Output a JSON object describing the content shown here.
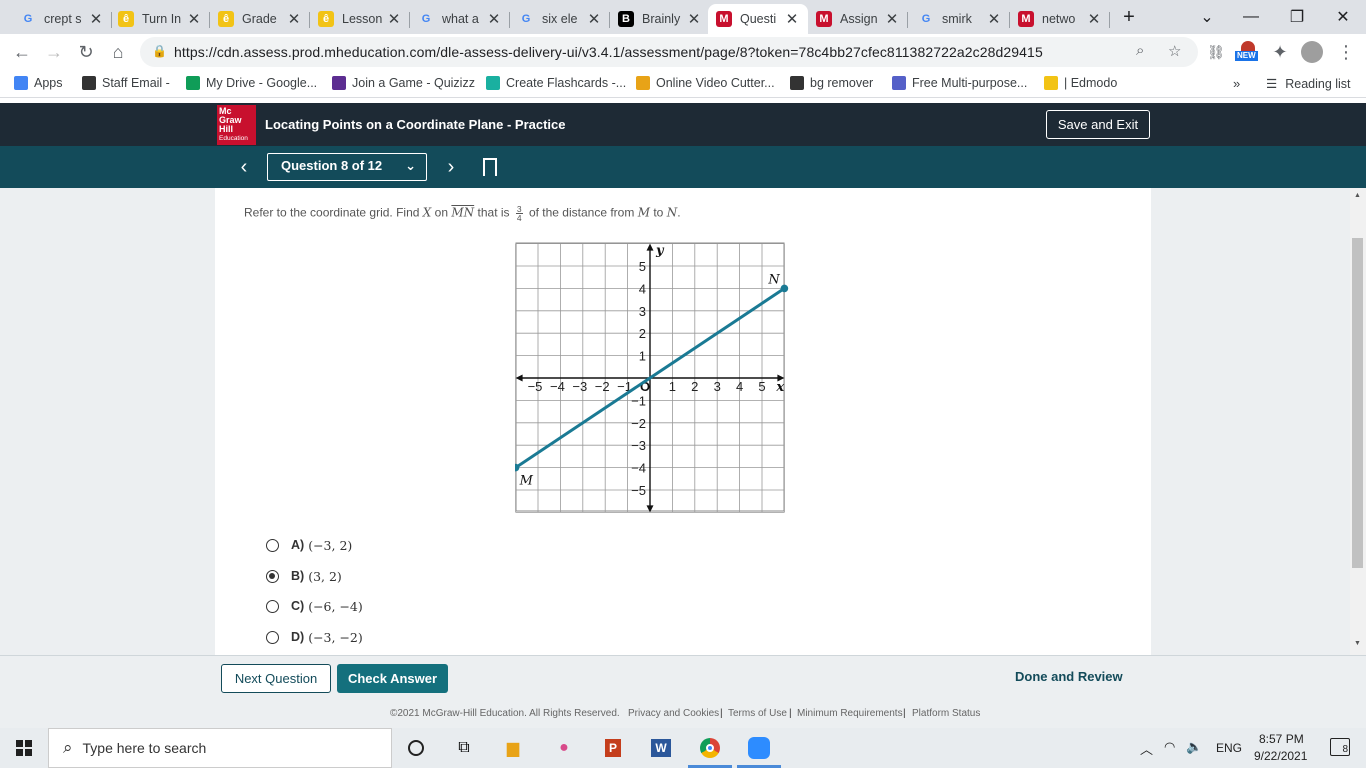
{
  "browser": {
    "tabs": [
      {
        "title": "crept s",
        "favicon": "google-icon",
        "color": "#4285f4",
        "glyph": "G"
      },
      {
        "title": "Turn In",
        "favicon": "edmodo-icon",
        "color": "#f2c315",
        "glyph": "ê"
      },
      {
        "title": "Grade",
        "favicon": "edmodo-icon",
        "color": "#f2c315",
        "glyph": "ê"
      },
      {
        "title": "Lesson",
        "favicon": "edmodo-icon",
        "color": "#f2c315",
        "glyph": "ê"
      },
      {
        "title": "what a",
        "favicon": "google-icon",
        "color": "#4285f4",
        "glyph": "G"
      },
      {
        "title": "six ele",
        "favicon": "google-icon",
        "color": "#4285f4",
        "glyph": "G"
      },
      {
        "title": "Brainly",
        "favicon": "brainly-icon",
        "color": "#000000",
        "glyph": "B"
      },
      {
        "title": "Questi",
        "favicon": "mcgraw-icon",
        "color": "#c8102e",
        "glyph": "M"
      },
      {
        "title": "Assign",
        "favicon": "mcgraw-m-icon",
        "color": "#c8102e",
        "glyph": "M"
      },
      {
        "title": "smirk",
        "favicon": "google-icon",
        "color": "#4285f4",
        "glyph": "G"
      },
      {
        "title": "netwo",
        "favicon": "mcgraw-icon",
        "color": "#c8102e",
        "glyph": "M"
      }
    ],
    "active_tab": 7,
    "url": "https://cdn.assess.prod.mheducation.com/dle-assess-delivery-ui/v3.4.1/assessment/page/8?token=78c4bb27cfec811382722a2c28d29415",
    "new_badge": "NEW",
    "bookmarks": [
      {
        "label": "Apps",
        "icon": "apps-grid-icon",
        "color": "#4285f4"
      },
      {
        "label": "Staff Email -",
        "icon": "globe-icon",
        "color": "#333333"
      },
      {
        "label": "My Drive - Google...",
        "icon": "drive-icon",
        "color": "#0f9d58"
      },
      {
        "label": "Join a Game - Quizizz",
        "icon": "quizizz-icon",
        "color": "#5c2d91"
      },
      {
        "label": "Create Flashcards -...",
        "icon": "flashcards-icon",
        "color": "#1ab0a0"
      },
      {
        "label": "Online Video Cutter...",
        "icon": "video-cutter-icon",
        "color": "#e8a317"
      },
      {
        "label": "bg remover",
        "icon": "bg-remover-icon",
        "color": "#333333"
      },
      {
        "label": "Free Multi-purpose...",
        "icon": "multi-purpose-icon",
        "color": "#5560c8"
      },
      {
        "label": "| Edmodo",
        "icon": "edmodo-icon",
        "color": "#f2c315"
      }
    ],
    "reading_list": "Reading list"
  },
  "app": {
    "logo_lines": [
      "Mc",
      "Graw",
      "Hill"
    ],
    "logo_sub": "Education",
    "title": "Locating Points on a Coordinate Plane - Practice",
    "save_exit": "Save and Exit",
    "question_select": "Question 8 of 12"
  },
  "question": {
    "prefix": "Refer to the coordinate grid. Find",
    "var_x": "X",
    "on": "on",
    "segment": "MN",
    "that_is": "that is",
    "frac_num": "3",
    "frac_den": "4",
    "of_dist": "of the distance from",
    "var_m": "M",
    "to": "to",
    "var_n": "N",
    "end": "."
  },
  "graph": {
    "x_label": "x",
    "y_label": "y",
    "x_ticks": [
      "−5",
      "−4",
      "−3",
      "−2",
      "−1",
      "1",
      "2",
      "3",
      "4",
      "5"
    ],
    "y_ticks": [
      "5",
      "4",
      "3",
      "2",
      "1",
      "−1",
      "−2",
      "−3",
      "−4",
      "−5"
    ],
    "origin_label": "O",
    "points": [
      {
        "label": "M",
        "x": -6,
        "y": -4
      },
      {
        "label": "N",
        "x": 6,
        "y": 4
      }
    ],
    "line_color": "#1a7a94"
  },
  "options": [
    {
      "letter": "A)",
      "value": "(−3, 2)",
      "selected": false
    },
    {
      "letter": "B)",
      "value": "(3, 2)",
      "selected": true
    },
    {
      "letter": "C)",
      "value": "(−6, −4)",
      "selected": false
    },
    {
      "letter": "D)",
      "value": "(−3, −2)",
      "selected": false
    }
  ],
  "footer": {
    "next_question": "Next Question",
    "check_answer": "Check Answer",
    "done_review": "Done and Review",
    "copyright": "©2021 McGraw-Hill Education. All Rights Reserved.",
    "links": [
      "Privacy and Cookies",
      "Terms of Use",
      "Minimum Requirements",
      "Platform Status"
    ]
  },
  "taskbar": {
    "search_placeholder": "Type here to search",
    "lang": "ENG",
    "time": "8:57 PM",
    "date": "9/22/2021",
    "notifications": "8"
  }
}
